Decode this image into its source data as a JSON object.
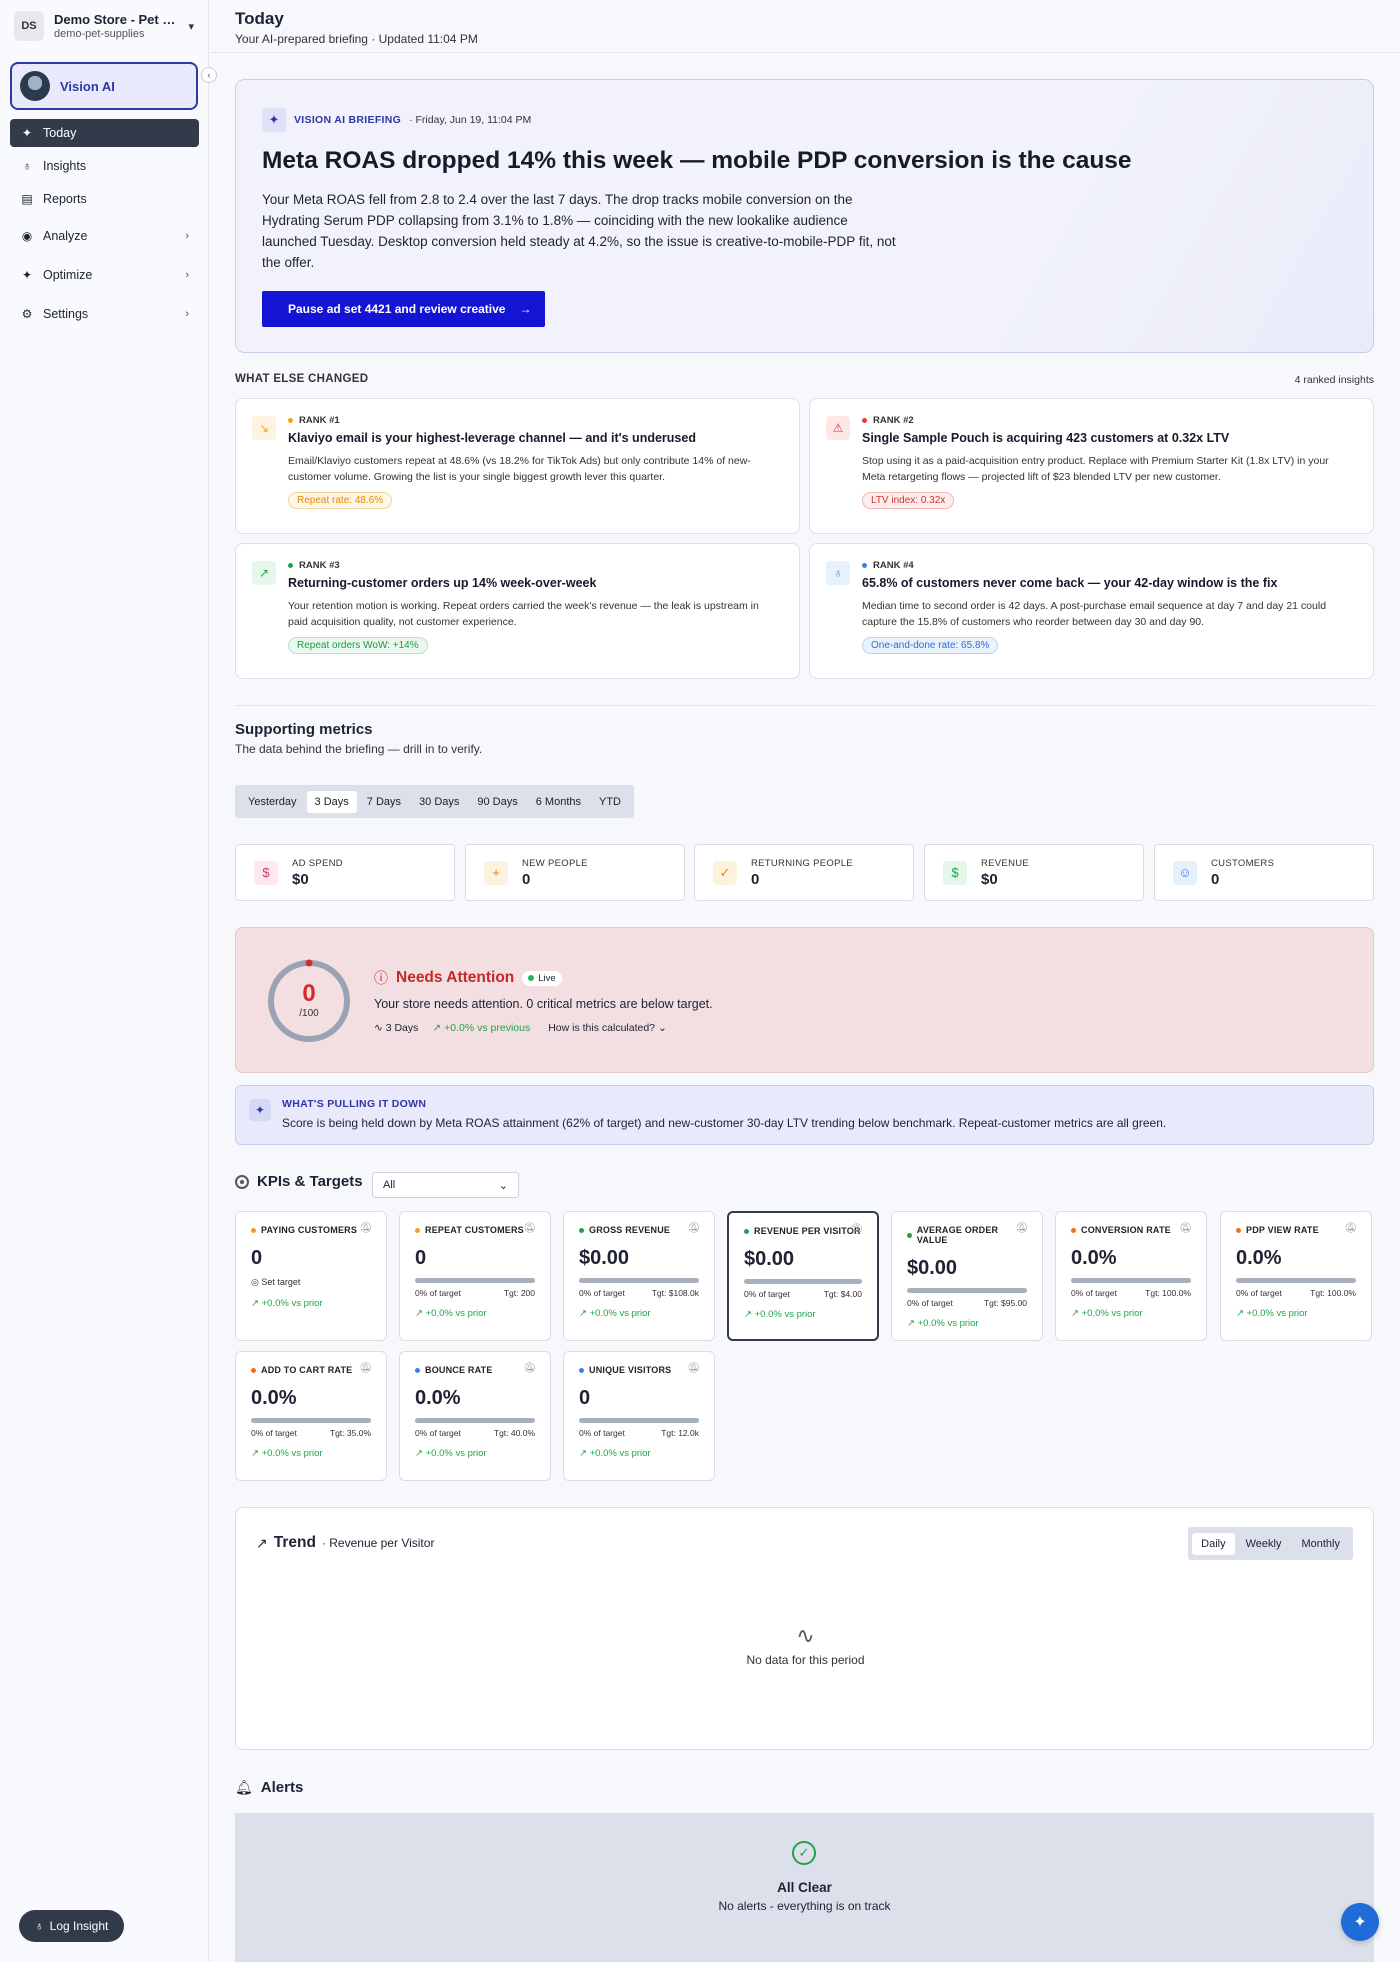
{
  "store": {
    "initials": "DS",
    "name": "Demo Store - Pet S...",
    "slug": "demo-pet-supplies"
  },
  "vision_label": "Vision AI",
  "nav": [
    {
      "label": "Today",
      "icon": "sparkle-icon"
    },
    {
      "label": "Insights",
      "icon": "lightbulb-icon"
    },
    {
      "label": "Reports",
      "icon": "document-icon"
    },
    {
      "label": "Analyze",
      "icon": "eye-icon"
    },
    {
      "label": "Optimize",
      "icon": "sparkle-icon"
    },
    {
      "label": "Settings",
      "icon": "gear-icon"
    }
  ],
  "log_insight": "Log Insight",
  "header": {
    "title": "Today",
    "subtitle": "Your AI-prepared briefing · Updated 11:04 PM"
  },
  "briefing": {
    "tag": "VISION AI BRIEFING",
    "date": "· Friday, Jun 19, 11:04 PM",
    "headline": "Meta ROAS dropped 14% this week — mobile PDP conversion is the cause",
    "body": "Your Meta ROAS fell from 2.8 to 2.4 over the last 7 days. The drop tracks mobile conversion on the Hydrating Serum PDP collapsing from 3.1% to 1.8% — coinciding with the new lookalike audience launched Tuesday. Desktop conversion held steady at 4.2%, so the issue is creative-to-mobile-PDP fit, not the offer.",
    "cta": "Pause ad set 4421 and review creative"
  },
  "what_else": {
    "label": "WHAT ELSE CHANGED",
    "count": "4 ranked insights"
  },
  "insights": [
    {
      "rank": "RANK #1",
      "title": "Klaviyo email is your highest-leverage channel — and it's underused",
      "body": "Email/Klaviyo customers repeat at 48.6% (vs 18.2% for TikTok Ads) but only contribute 14% of new-customer volume. Growing the list is your single biggest growth lever this quarter.",
      "pill": "Repeat rate: 48.6%",
      "color": "#f0a020"
    },
    {
      "rank": "RANK #2",
      "title": "Single Sample Pouch is acquiring 423 customers at 0.32x LTV",
      "body": "Stop using it as a paid-acquisition entry product. Replace with Premium Starter Kit (1.8x LTV) in your Meta retargeting flows — projected lift of $23 blended LTV per new customer.",
      "pill": "LTV index: 0.32x",
      "color": "#e03b3b"
    },
    {
      "rank": "RANK #3",
      "title": "Returning-customer orders up 14% week-over-week",
      "body": "Your retention motion is working. Repeat orders carried the week's revenue — the leak is upstream in paid acquisition quality, not customer experience.",
      "pill": "Repeat orders WoW: +14%",
      "color": "#22a34a"
    },
    {
      "rank": "RANK #4",
      "title": "65.8% of customers never come back — your 42-day window is the fix",
      "body": "Median time to second order is 42 days. A post-purchase email sequence at day 7 and day 21 could capture the 15.8% of customers who reorder between day 30 and day 90.",
      "pill": "One-and-done rate: 65.8%",
      "color": "#3b82e0"
    }
  ],
  "supporting": {
    "title": "Supporting metrics",
    "subtitle": "The data behind the briefing — drill in to verify.",
    "ranges": [
      "Yesterday",
      "3 Days",
      "7 Days",
      "30 Days",
      "90 Days",
      "6 Months",
      "YTD"
    ],
    "active_range": "3 Days"
  },
  "summary": [
    {
      "label": "AD SPEND",
      "value": "$0"
    },
    {
      "label": "NEW PEOPLE",
      "value": "0"
    },
    {
      "label": "RETURNING PEOPLE",
      "value": "0"
    },
    {
      "label": "REVENUE",
      "value": "$0"
    },
    {
      "label": "CUSTOMERS",
      "value": "0"
    }
  ],
  "health": {
    "score": "0",
    "denominator": "/100",
    "status": "Needs Attention",
    "live": "Live",
    "description": "Your store needs attention. 0 critical metrics are below target.",
    "period": "3 Days",
    "change": "+0.0% vs previous",
    "how": "How is this calculated?"
  },
  "pulling": {
    "title": "WHAT'S PULLING IT DOWN",
    "body": "Score is being held down by Meta ROAS attainment (62% of target) and new-customer 30-day LTV trending below benchmark. Repeat-customer metrics are all green."
  },
  "kpis": {
    "title": "KPIs & Targets",
    "filter": "All",
    "cards": [
      {
        "label": "PAYING CUSTOMERS",
        "value": "0",
        "set_target": "Set target",
        "change": "+0.0% vs prior",
        "dot": "#f0a020"
      },
      {
        "label": "REPEAT CUSTOMERS",
        "value": "0",
        "pct": "0% of target",
        "tgt": "Tgt: 200",
        "change": "+0.0% vs prior",
        "dot": "#f0a020"
      },
      {
        "label": "GROSS REVENUE",
        "value": "$0.00",
        "pct": "0% of target",
        "tgt": "Tgt: $108.0k",
        "change": "+0.0% vs prior",
        "dot": "#22a34a"
      },
      {
        "label": "REVENUE PER VISITOR",
        "value": "$0.00",
        "pct": "0% of target",
        "tgt": "Tgt: $4.00",
        "change": "+0.0% vs prior",
        "dot": "#22a34a"
      },
      {
        "label": "AVERAGE ORDER VALUE",
        "value": "$0.00",
        "pct": "0% of target",
        "tgt": "Tgt: $95.00",
        "change": "+0.0% vs prior",
        "dot": "#22a34a"
      },
      {
        "label": "CONVERSION RATE",
        "value": "0.0%",
        "pct": "0% of target",
        "tgt": "Tgt: 100.0%",
        "change": "+0.0% vs prior",
        "dot": "#f07020"
      },
      {
        "label": "PDP VIEW RATE",
        "value": "0.0%",
        "pct": "0% of target",
        "tgt": "Tgt: 100.0%",
        "change": "+0.0% vs prior",
        "dot": "#f07020"
      },
      {
        "label": "ADD TO CART RATE",
        "value": "0.0%",
        "pct": "0% of target",
        "tgt": "Tgt: 35.0%",
        "change": "+0.0% vs prior",
        "dot": "#f07020"
      },
      {
        "label": "BOUNCE RATE",
        "value": "0.0%",
        "pct": "0% of target",
        "tgt": "Tgt: 40.0%",
        "change": "+0.0% vs prior",
        "dot": "#3b82e0"
      },
      {
        "label": "UNIQUE VISITORS",
        "value": "0",
        "pct": "0% of target",
        "tgt": "Tgt: 12.0k",
        "change": "+0.0% vs prior",
        "dot": "#3b82e0"
      }
    ]
  },
  "trend": {
    "title": "Trend",
    "subtitle": "· Revenue per Visitor",
    "options": [
      "Daily",
      "Weekly",
      "Monthly"
    ],
    "active": "Daily",
    "empty": "No data for this period"
  },
  "alerts": {
    "title": "Alerts",
    "clear_title": "All Clear",
    "clear_body": "No alerts - everything is on track"
  }
}
